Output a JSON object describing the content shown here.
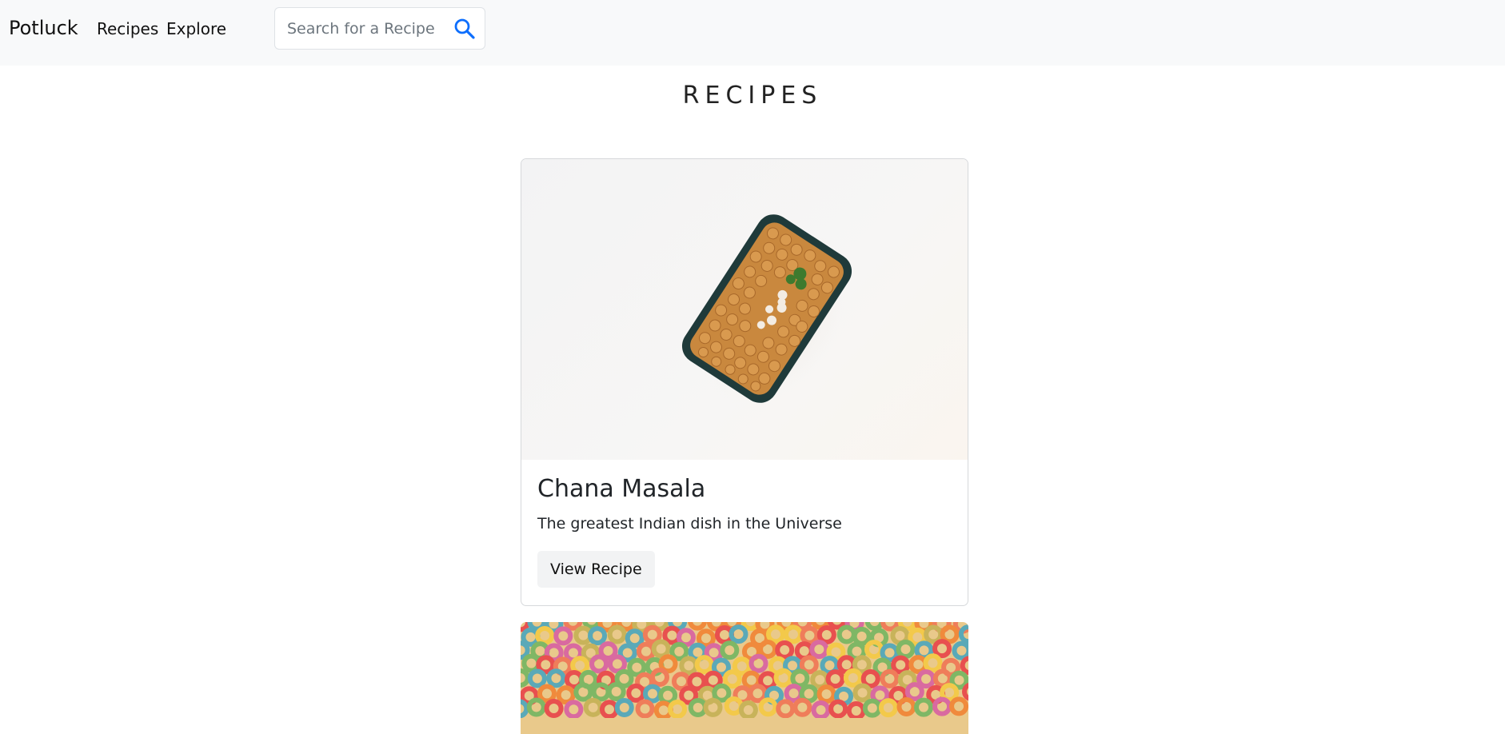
{
  "navbar": {
    "brand": "Potluck",
    "links": [
      "Recipes",
      "Explore"
    ],
    "search_placeholder": "Search for a Recipe",
    "accent_color": "#0d6efd"
  },
  "page": {
    "title": "RECIPES"
  },
  "recipes": [
    {
      "title": "Chana Masala",
      "description": "The greatest Indian dish in the Universe",
      "button_label": "View Recipe",
      "image_icon": "chickpea-container-image"
    },
    {
      "image_icon": "fruit-loops-cereal-image"
    }
  ]
}
